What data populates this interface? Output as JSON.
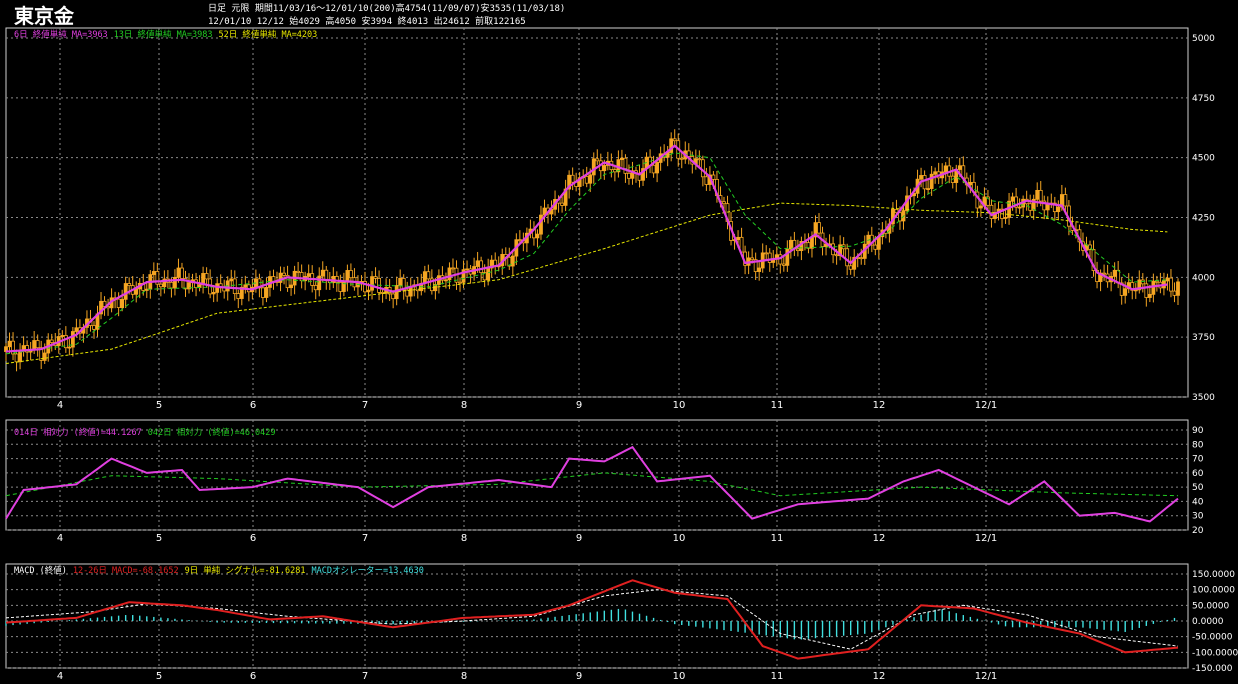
{
  "title": "東京金",
  "header": {
    "line1": "日足 元限 期間11/03/16〜12/01/10(200)高4754(11/09/07)安3535(11/03/18)",
    "line2": "12/01/10 12/12 始4029 高4050 安3994 終4013 出24612 前取122165"
  },
  "colors": {
    "ma6": "#e040e0",
    "ma13": "#22cc22",
    "ma52": "#e6e600",
    "candle": "#f5a623",
    "rsi14": "#e040e0",
    "rsi42": "#22cc22",
    "macd": "#e02020",
    "signal": "#ffffff",
    "hist": "#40e0e0",
    "grid": "#8a8a8a"
  },
  "x_ticks": [
    "4",
    "5",
    "6",
    "7",
    "8",
    "9",
    "10",
    "11",
    "12",
    "12/1"
  ],
  "price_panel": {
    "legend": [
      {
        "text": "6日 終値単純 MA=3963",
        "color": "#e040e0"
      },
      {
        "text": "13日 終値単純 MA=3983",
        "color": "#22cc22"
      },
      {
        "text": "52日 終値単純 MA=4203",
        "color": "#e6e600"
      }
    ],
    "y_ticks": [
      "5000",
      "4750",
      "4500",
      "4250",
      "4000",
      "3750",
      "3500"
    ]
  },
  "rsi_panel": {
    "legend": [
      {
        "text": "014日 相対力 (終値)=44.1267",
        "color": "#e040e0"
      },
      {
        "text": "042日 相対力 (終値)=46.0429",
        "color": "#22cc22"
      }
    ],
    "y_ticks": [
      "90",
      "80",
      "70",
      "60",
      "50",
      "40",
      "30",
      "20"
    ]
  },
  "macd_panel": {
    "legend": [
      {
        "text": "MACD (終値)",
        "color": "#ffffff"
      },
      {
        "text": "12-26日 MACD=-68.1652",
        "color": "#e02020"
      },
      {
        "text": "9日 単純 シグナル=-81.6281",
        "color": "#e6e600"
      },
      {
        "text": "MACDオシレーター=13.4630",
        "color": "#40e0e0"
      }
    ],
    "y_ticks": [
      "150.0000",
      "100.0000",
      "50.0000",
      "0.0000",
      "-50.0000",
      "-100.0000",
      "-150.000"
    ]
  },
  "chart_data": [
    {
      "type": "line",
      "title": "東京金",
      "xlabel": "",
      "ylabel": "",
      "ylim": [
        3500,
        5000
      ],
      "x_ticks": [
        "4",
        "5",
        "6",
        "7",
        "8",
        "9",
        "10",
        "11",
        "12",
        "12/1"
      ],
      "series": [
        {
          "name": "6日 終値単純 MA",
          "points": [
            [
              0,
              3690
            ],
            [
              10,
              3700
            ],
            [
              20,
              3760
            ],
            [
              30,
              3900
            ],
            [
              40,
              3980
            ],
            [
              50,
              3990
            ],
            [
              60,
              3960
            ],
            [
              70,
              3950
            ],
            [
              80,
              4000
            ],
            [
              90,
              3990
            ],
            [
              100,
              3980
            ],
            [
              110,
              3940
            ],
            [
              120,
              3980
            ],
            [
              130,
              4020
            ],
            [
              140,
              4050
            ],
            [
              150,
              4200
            ],
            [
              160,
              4380
            ],
            [
              170,
              4480
            ],
            [
              180,
              4430
            ],
            [
              190,
              4550
            ],
            [
              200,
              4420
            ],
            [
              210,
              4060
            ],
            [
              220,
              4080
            ],
            [
              230,
              4180
            ],
            [
              240,
              4060
            ],
            [
              250,
              4200
            ],
            [
              260,
              4400
            ],
            [
              270,
              4450
            ],
            [
              280,
              4260
            ],
            [
              290,
              4320
            ],
            [
              300,
              4300
            ],
            [
              310,
              4020
            ],
            [
              320,
              3950
            ],
            [
              330,
              3970
            ]
          ]
        },
        {
          "name": "13日 終値単純 MA",
          "points": [
            [
              0,
              3680
            ],
            [
              20,
              3720
            ],
            [
              30,
              3830
            ],
            [
              40,
              3950
            ],
            [
              60,
              3960
            ],
            [
              80,
              3990
            ],
            [
              100,
              3970
            ],
            [
              120,
              3960
            ],
            [
              140,
              4030
            ],
            [
              150,
              4100
            ],
            [
              160,
              4280
            ],
            [
              170,
              4430
            ],
            [
              180,
              4470
            ],
            [
              190,
              4520
            ],
            [
              200,
              4500
            ],
            [
              210,
              4260
            ],
            [
              220,
              4120
            ],
            [
              240,
              4130
            ],
            [
              250,
              4180
            ],
            [
              260,
              4330
            ],
            [
              270,
              4420
            ],
            [
              280,
              4320
            ],
            [
              290,
              4300
            ],
            [
              300,
              4220
            ],
            [
              310,
              4100
            ],
            [
              320,
              3980
            ],
            [
              330,
              3990
            ]
          ]
        },
        {
          "name": "52日 終値単純 MA",
          "points": [
            [
              0,
              3640
            ],
            [
              30,
              3700
            ],
            [
              60,
              3850
            ],
            [
              100,
              3920
            ],
            [
              140,
              3990
            ],
            [
              170,
              4120
            ],
            [
              200,
              4260
            ],
            [
              220,
              4310
            ],
            [
              240,
              4300
            ],
            [
              260,
              4280
            ],
            [
              280,
              4270
            ],
            [
              300,
              4240
            ],
            [
              320,
              4200
            ],
            [
              330,
              4190
            ]
          ]
        }
      ]
    },
    {
      "type": "line",
      "title": "相対力",
      "ylim": [
        20,
        90
      ],
      "series": [
        {
          "name": "014日 相対力 (終値)",
          "points": [
            [
              0,
              28
            ],
            [
              5,
              48
            ],
            [
              20,
              52
            ],
            [
              30,
              70
            ],
            [
              40,
              60
            ],
            [
              50,
              62
            ],
            [
              55,
              48
            ],
            [
              70,
              50
            ],
            [
              80,
              56
            ],
            [
              100,
              50
            ],
            [
              110,
              36
            ],
            [
              120,
              50
            ],
            [
              140,
              55
            ],
            [
              155,
              50
            ],
            [
              160,
              70
            ],
            [
              170,
              68
            ],
            [
              178,
              78
            ],
            [
              185,
              54
            ],
            [
              200,
              58
            ],
            [
              212,
              28
            ],
            [
              225,
              38
            ],
            [
              245,
              42
            ],
            [
              255,
              54
            ],
            [
              265,
              62
            ],
            [
              275,
              50
            ],
            [
              285,
              38
            ],
            [
              295,
              54
            ],
            [
              305,
              30
            ],
            [
              315,
              32
            ],
            [
              325,
              26
            ],
            [
              333,
              42
            ]
          ]
        },
        {
          "name": "042日 相対力 (終値)",
          "points": [
            [
              0,
              44
            ],
            [
              30,
              58
            ],
            [
              60,
              56
            ],
            [
              100,
              50
            ],
            [
              140,
              52
            ],
            [
              170,
              60
            ],
            [
              200,
              54
            ],
            [
              220,
              44
            ],
            [
              260,
              50
            ],
            [
              300,
              46
            ],
            [
              333,
              44
            ]
          ]
        }
      ]
    },
    {
      "type": "bar",
      "title": "MACD (終値)",
      "ylim": [
        -150,
        150
      ],
      "series": [
        {
          "name": "12-26日 MACD",
          "points": [
            [
              0,
              -5
            ],
            [
              20,
              10
            ],
            [
              35,
              60
            ],
            [
              50,
              50
            ],
            [
              60,
              35
            ],
            [
              75,
              5
            ],
            [
              90,
              15
            ],
            [
              110,
              -20
            ],
            [
              130,
              10
            ],
            [
              150,
              20
            ],
            [
              160,
              50
            ],
            [
              178,
              130
            ],
            [
              190,
              90
            ],
            [
              205,
              70
            ],
            [
              215,
              -80
            ],
            [
              225,
              -120
            ],
            [
              245,
              -90
            ],
            [
              260,
              50
            ],
            [
              275,
              40
            ],
            [
              290,
              -5
            ],
            [
              305,
              -40
            ],
            [
              318,
              -100
            ],
            [
              333,
              -85
            ]
          ]
        },
        {
          "name": "9日 単純 シグナル",
          "points": [
            [
              0,
              10
            ],
            [
              25,
              30
            ],
            [
              40,
              55
            ],
            [
              60,
              40
            ],
            [
              80,
              15
            ],
            [
              110,
              -10
            ],
            [
              130,
              0
            ],
            [
              150,
              15
            ],
            [
              170,
              80
            ],
            [
              185,
              100
            ],
            [
              205,
              80
            ],
            [
              220,
              -40
            ],
            [
              240,
              -90
            ],
            [
              258,
              20
            ],
            [
              272,
              50
            ],
            [
              290,
              20
            ],
            [
              310,
              -50
            ],
            [
              333,
              -80
            ]
          ]
        },
        {
          "name": "MACDオシレーター",
          "points": [
            [
              0,
              -15
            ],
            [
              35,
              20
            ],
            [
              60,
              -5
            ],
            [
              110,
              -10
            ],
            [
              150,
              5
            ],
            [
              175,
              40
            ],
            [
              190,
              -10
            ],
            [
              212,
              -40
            ],
            [
              225,
              -60
            ],
            [
              245,
              -40
            ],
            [
              265,
              40
            ],
            [
              285,
              -20
            ],
            [
              305,
              -20
            ],
            [
              318,
              -35
            ],
            [
              333,
              13
            ]
          ]
        }
      ]
    }
  ]
}
